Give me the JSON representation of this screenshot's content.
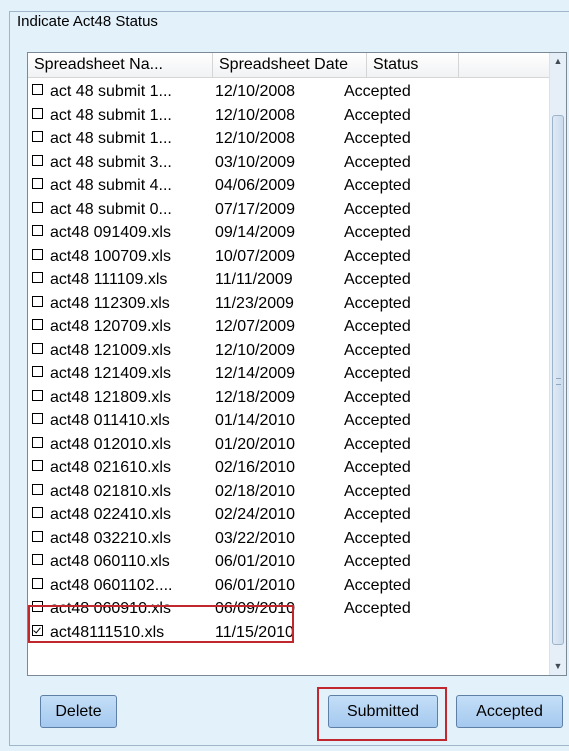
{
  "group": {
    "title": "Indicate Act48 Status"
  },
  "table": {
    "columns": [
      "Spreadsheet Na...",
      "Spreadsheet Date",
      "Status"
    ],
    "rows": [
      {
        "name": "act 48 submit 1...",
        "date": "12/10/2008",
        "status": "Accepted",
        "checked": false
      },
      {
        "name": "act 48 submit 1...",
        "date": "12/10/2008",
        "status": "Accepted",
        "checked": false
      },
      {
        "name": "act 48 submit 1...",
        "date": "12/10/2008",
        "status": "Accepted",
        "checked": false
      },
      {
        "name": "act 48 submit 3...",
        "date": "03/10/2009",
        "status": "Accepted",
        "checked": false
      },
      {
        "name": "act 48 submit 4...",
        "date": "04/06/2009",
        "status": "Accepted",
        "checked": false
      },
      {
        "name": "act 48 submit 0...",
        "date": "07/17/2009",
        "status": "Accepted",
        "checked": false
      },
      {
        "name": "act48 091409.xls",
        "date": "09/14/2009",
        "status": "Accepted",
        "checked": false
      },
      {
        "name": "act48 100709.xls",
        "date": "10/07/2009",
        "status": "Accepted",
        "checked": false
      },
      {
        "name": "act48 111109.xls",
        "date": "11/11/2009",
        "status": "Accepted",
        "checked": false
      },
      {
        "name": "act48 112309.xls",
        "date": "11/23/2009",
        "status": "Accepted",
        "checked": false
      },
      {
        "name": "act48 120709.xls",
        "date": "12/07/2009",
        "status": "Accepted",
        "checked": false
      },
      {
        "name": "act48 121009.xls",
        "date": "12/10/2009",
        "status": "Accepted",
        "checked": false
      },
      {
        "name": "act48 121409.xls",
        "date": "12/14/2009",
        "status": "Accepted",
        "checked": false
      },
      {
        "name": "act48 121809.xls",
        "date": "12/18/2009",
        "status": "Accepted",
        "checked": false
      },
      {
        "name": "act48 011410.xls",
        "date": "01/14/2010",
        "status": "Accepted",
        "checked": false
      },
      {
        "name": "act48 012010.xls",
        "date": "01/20/2010",
        "status": "Accepted",
        "checked": false
      },
      {
        "name": "act48 021610.xls",
        "date": "02/16/2010",
        "status": "Accepted",
        "checked": false
      },
      {
        "name": "act48 021810.xls",
        "date": "02/18/2010",
        "status": "Accepted",
        "checked": false
      },
      {
        "name": "act48 022410.xls",
        "date": "02/24/2010",
        "status": "Accepted",
        "checked": false
      },
      {
        "name": "act48 032210.xls",
        "date": "03/22/2010",
        "status": "Accepted",
        "checked": false
      },
      {
        "name": "act48 060110.xls",
        "date": "06/01/2010",
        "status": "Accepted",
        "checked": false
      },
      {
        "name": "act48 0601102....",
        "date": "06/01/2010",
        "status": "Accepted",
        "checked": false
      },
      {
        "name": "act48 060910.xls",
        "date": "06/09/2010",
        "status": "Accepted",
        "checked": false
      },
      {
        "name": "act48111510.xls",
        "date": "11/15/2010",
        "status": "",
        "checked": true
      }
    ]
  },
  "buttons": {
    "delete": "Delete",
    "submitted": "Submitted",
    "accepted": "Accepted"
  },
  "colors": {
    "background": "#e3f1fb",
    "button": "#b4d3f3",
    "highlight": "#c0282e"
  }
}
